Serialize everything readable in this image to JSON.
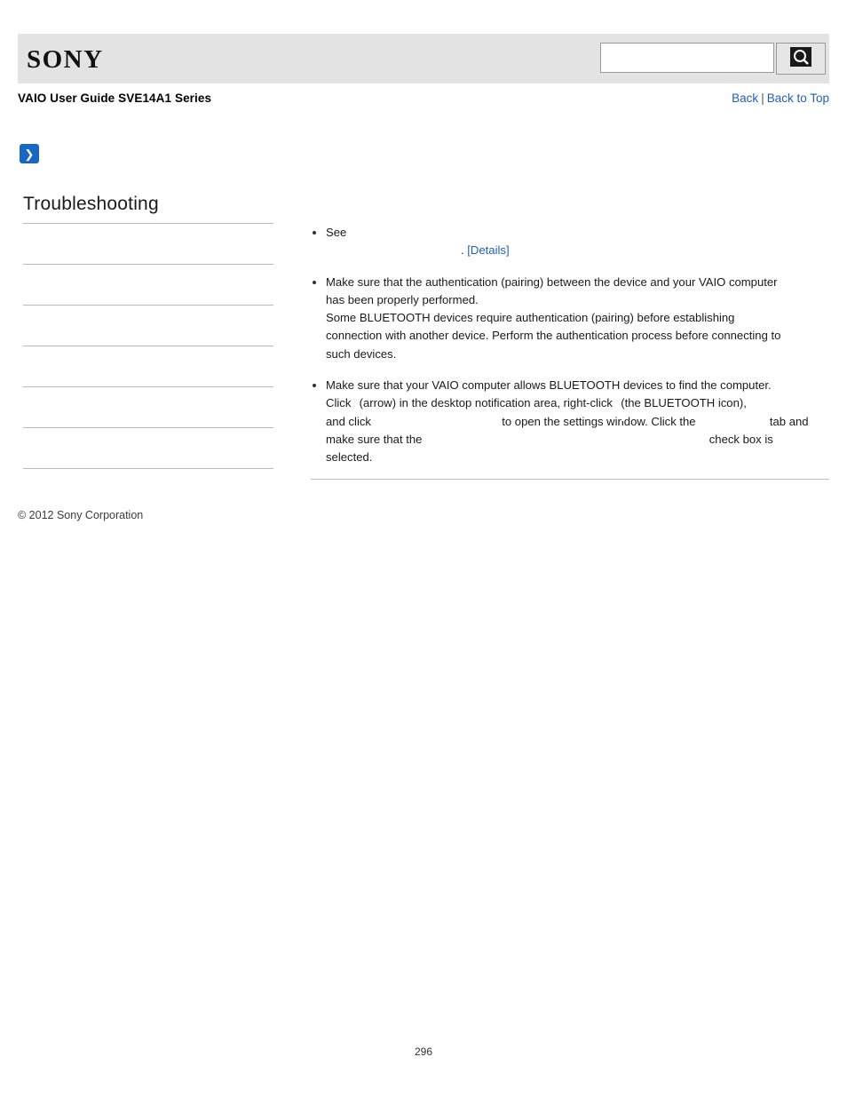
{
  "header": {
    "logo_text": "SONY",
    "search": {
      "value": "",
      "placeholder": "",
      "button_icon": "search-icon"
    }
  },
  "title_row": {
    "guide_title": "VAIO User Guide SVE14A1 Series",
    "back_label": "Back",
    "separator": "|",
    "back_to_top_label": "Back to Top"
  },
  "marker": {
    "glyph": "❯"
  },
  "sidebar": {
    "heading": "Troubleshooting",
    "items": [
      {
        "label": ""
      },
      {
        "label": ""
      },
      {
        "label": ""
      },
      {
        "label": ""
      },
      {
        "label": ""
      },
      {
        "label": ""
      }
    ]
  },
  "content": {
    "bullets": [
      {
        "line1": "See",
        "line2_prefix": ".",
        "details_label": "[Details]"
      },
      {
        "line1": "Make sure that the authentication (pairing) between the device and your VAIO computer",
        "line2": "has been properly performed.",
        "line3": "Some BLUETOOTH devices require authentication (pairing) before establishing",
        "line4": "connection with another device. Perform the authentication process before connecting to",
        "line5": "such devices."
      },
      {
        "line1": "Make sure that your VAIO computer allows BLUETOOTH devices to find the computer.",
        "line2_a": "Click",
        "line2_b": "(arrow) in the desktop notification area, right-click",
        "line2_c": "(the BLUETOOTH icon),",
        "line3_a": "and click",
        "line3_b": "to open the settings window. Click the",
        "line3_c": "tab and",
        "line4_a": "make sure that the",
        "line4_b": "check box is",
        "line5": "selected."
      }
    ]
  },
  "footer": {
    "copyright": "© 2012 Sony Corporation",
    "page_number": "296"
  },
  "colors": {
    "link": "#1f5fbf",
    "header_bg": "#e3e3e3",
    "marker_blue": "#1767c4",
    "bluetooth_blue": "#1565c0"
  }
}
